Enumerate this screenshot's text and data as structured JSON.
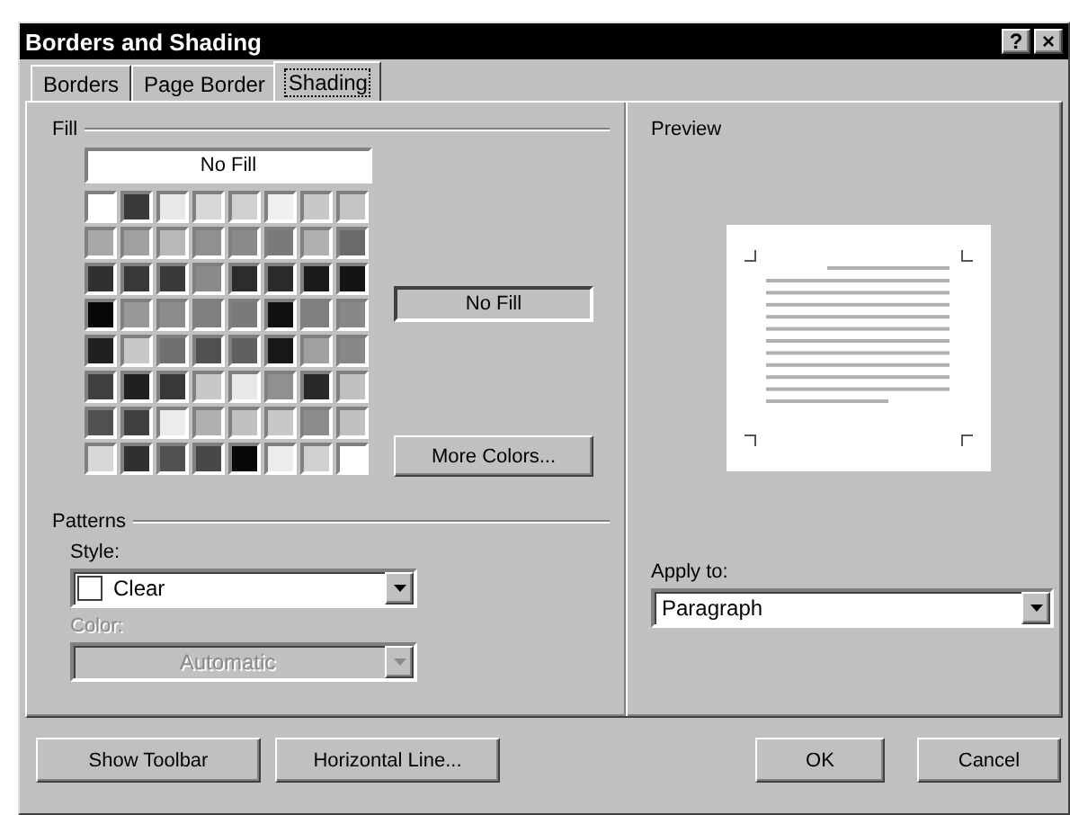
{
  "window": {
    "title": "Borders and Shading",
    "controls": [
      {
        "label": "?"
      },
      {
        "label": "×"
      }
    ]
  },
  "tabs": [
    {
      "label": "Borders",
      "selected": false
    },
    {
      "label": "Page Border",
      "selected": false
    },
    {
      "label": "Shading",
      "selected": true
    }
  ],
  "fill": {
    "label": "Fill",
    "no_fill_button": "No Fill",
    "swatch_rows": [
      [
        {
          "color": "#ffffff"
        },
        {
          "color": "#3a3a3a"
        },
        {
          "color": "#e8e8e8"
        },
        {
          "color": "#d8d8d8"
        },
        {
          "color": "#d0d0d0"
        },
        {
          "color": "#f0f0f0"
        },
        {
          "color": "#c8c8c8"
        },
        {
          "color": "#c4c4c4"
        }
      ],
      [
        {
          "color": "#a8a8a8"
        },
        {
          "color": "#a0a0a0"
        },
        {
          "color": "#b8b8b8"
        },
        {
          "color": "#909090"
        },
        {
          "color": "#8a8a8a"
        },
        {
          "color": "#7a7a7a"
        },
        {
          "color": "#b0b0b0"
        },
        {
          "color": "#6a6a6a"
        }
      ],
      [
        {
          "color": "#303030"
        },
        {
          "color": "#383838"
        },
        {
          "color": "#3a3a3a"
        },
        {
          "color": "#8a8a8a"
        },
        {
          "color": "#2c2c2c"
        },
        {
          "color": "#2a2a2a"
        },
        {
          "color": "#1a1a1a"
        },
        {
          "color": "#141414"
        }
      ],
      [
        {
          "color": "#080808"
        },
        {
          "color": "#989898"
        },
        {
          "color": "#8c8c8c"
        },
        {
          "color": "#808080"
        },
        {
          "color": "#7a7a7a"
        },
        {
          "color": "#101010"
        },
        {
          "color": "#808080"
        },
        {
          "color": "#888888"
        }
      ],
      [
        {
          "color": "#202020"
        },
        {
          "color": "#c8c8c8"
        },
        {
          "color": "#707070"
        },
        {
          "color": "#505050"
        },
        {
          "color": "#606060"
        },
        {
          "color": "#181818"
        },
        {
          "color": "#a0a0a0"
        },
        {
          "color": "#888888"
        }
      ],
      [
        {
          "color": "#404040"
        },
        {
          "color": "#202020"
        },
        {
          "color": "#383838"
        },
        {
          "color": "#c8c8c8"
        },
        {
          "color": "#e8e8e8"
        },
        {
          "color": "#909090"
        },
        {
          "color": "#282828"
        },
        {
          "color": "#c0c0c0"
        }
      ],
      [
        {
          "color": "#505050"
        },
        {
          "color": "#404040"
        },
        {
          "color": "#ececec"
        },
        {
          "color": "#b0b0b0"
        },
        {
          "color": "#c0c0c0"
        },
        {
          "color": "#c8c8c8"
        },
        {
          "color": "#8c8c8c"
        },
        {
          "color": "#c0c0c0"
        }
      ],
      [
        {
          "color": "#d8d8d8"
        },
        {
          "color": "#303030"
        },
        {
          "color": "#505050"
        },
        {
          "color": "#484848"
        },
        {
          "color": "#080808"
        },
        {
          "color": "#ececec"
        },
        {
          "color": "#d0d0d0"
        },
        {
          "color": "#ffffff"
        }
      ]
    ],
    "current": "No Fill",
    "more_colors_button": "More Colors..."
  },
  "patterns": {
    "label": "Patterns",
    "style_label": "Style:",
    "style_value": "Clear",
    "color_label": "Color:",
    "color_value": "Automatic",
    "color_disabled": true
  },
  "preview": {
    "label": "Preview"
  },
  "apply_to": {
    "label": "Apply to:",
    "value": "Paragraph"
  },
  "buttons": [
    {
      "kind": "left",
      "label": "Show Toolbar"
    },
    {
      "kind": "left",
      "label": "Horizontal Line..."
    },
    {
      "kind": "right",
      "label": "OK"
    },
    {
      "kind": "right",
      "label": "Cancel"
    }
  ]
}
